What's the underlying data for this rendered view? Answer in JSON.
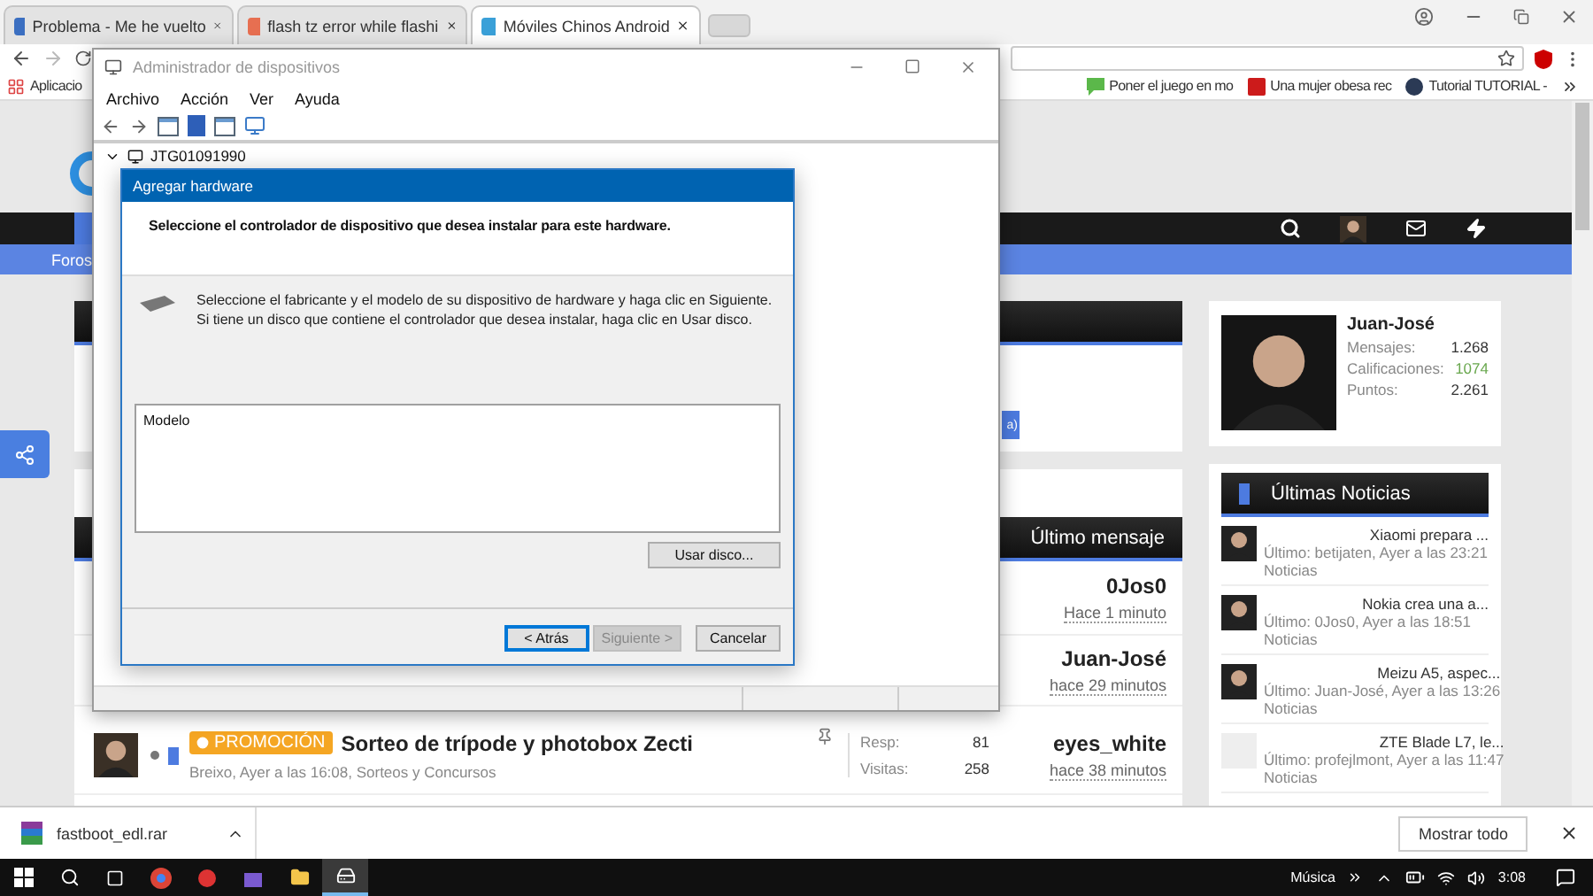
{
  "browser": {
    "tabs": [
      {
        "title": "Problema - Me he vuelto",
        "selected": false
      },
      {
        "title": "flash tz error while flashi",
        "selected": false
      },
      {
        "title": "Móviles Chinos Android",
        "selected": true
      }
    ],
    "bookmarks": [
      {
        "label": "Aplicacio"
      },
      {
        "label": "Poner el juego en mo"
      },
      {
        "label": "Una mujer obesa rec"
      },
      {
        "label": "Tutorial TUTORIAL -"
      }
    ]
  },
  "device_manager": {
    "title": "Administrador de dispositivos",
    "menu": [
      "Archivo",
      "Acción",
      "Ver",
      "Ayuda"
    ],
    "tree_root": "JTG01091990",
    "expanded": true
  },
  "dialog": {
    "title": "Agregar hardware",
    "heading": "Seleccione el controlador de dispositivo que desea instalar para este hardware.",
    "description": "Seleccione el fabricante y el modelo de su dispositivo de hardware y haga clic en Siguiente. Si tiene un disco que contiene el controlador que desea instalar, haga clic en  Usar disco.",
    "list_header": "Modelo",
    "disk_button": "Usar disco...",
    "buttons": [
      {
        "label": "< Atrás",
        "disabled": false,
        "focused": true
      },
      {
        "label": "Siguiente >",
        "disabled": true,
        "focused": false
      },
      {
        "label": "Cancelar",
        "disabled": false,
        "focused": false
      }
    ]
  },
  "site": {
    "subnav": [
      "Foros"
    ],
    "card_button": "a)",
    "topics": {
      "header": "Último mensaje",
      "rows": [
        {
          "kind": "covered",
          "last_user": "0Jos0",
          "last_time": "Hace 1 minuto"
        },
        {
          "kind": "covered",
          "last_user": "Juan-José",
          "last_time": "hace 29 minutos"
        },
        {
          "kind": "full",
          "badge": "PROMOCIÓN",
          "title": "Sorteo de trípode y photobox Zecti",
          "meta": "Breixo, Ayer a las 16:08, Sorteos y Concursos",
          "stats": [
            {
              "label": "Resp:",
              "value": "81"
            },
            {
              "label": "Visitas:",
              "value": "258"
            }
          ],
          "last_user": "eyes_white",
          "last_time": "hace 38 minutos"
        }
      ]
    },
    "profile": {
      "name": "Juan-José",
      "stats": [
        {
          "label": "Mensajes:",
          "value": "1.268",
          "color": "#333333"
        },
        {
          "label": "Calificaciones:",
          "value": "1074",
          "color": "#6aa84f"
        },
        {
          "label": "Puntos:",
          "value": "2.261",
          "color": "#333333"
        }
      ]
    },
    "news": {
      "title": "Últimas Noticias",
      "items": [
        {
          "kind": "photo",
          "title": "Xiaomi prepara ...",
          "byline": "Último: betijaten, Ayer a las 23:21",
          "category": "Noticias"
        },
        {
          "kind": "photo",
          "title": "Nokia crea una a...",
          "byline": "Último: 0Jos0, Ayer a las 18:51",
          "category": "Noticias"
        },
        {
          "kind": "photo",
          "title": "Meizu A5, aspec...",
          "byline": "Último: Juan-José, Ayer a las 13:26",
          "category": "Noticias"
        },
        {
          "kind": "placeholder",
          "title": "ZTE Blade L7, le...",
          "byline": "Último: profejlmont, Ayer a las 11:47",
          "category": "Noticias"
        }
      ]
    }
  },
  "download": {
    "file": "fastboot_edl.rar",
    "button": "Mostrar todo"
  },
  "taskbar": {
    "tray_label": "Música",
    "time": "3:08"
  }
}
